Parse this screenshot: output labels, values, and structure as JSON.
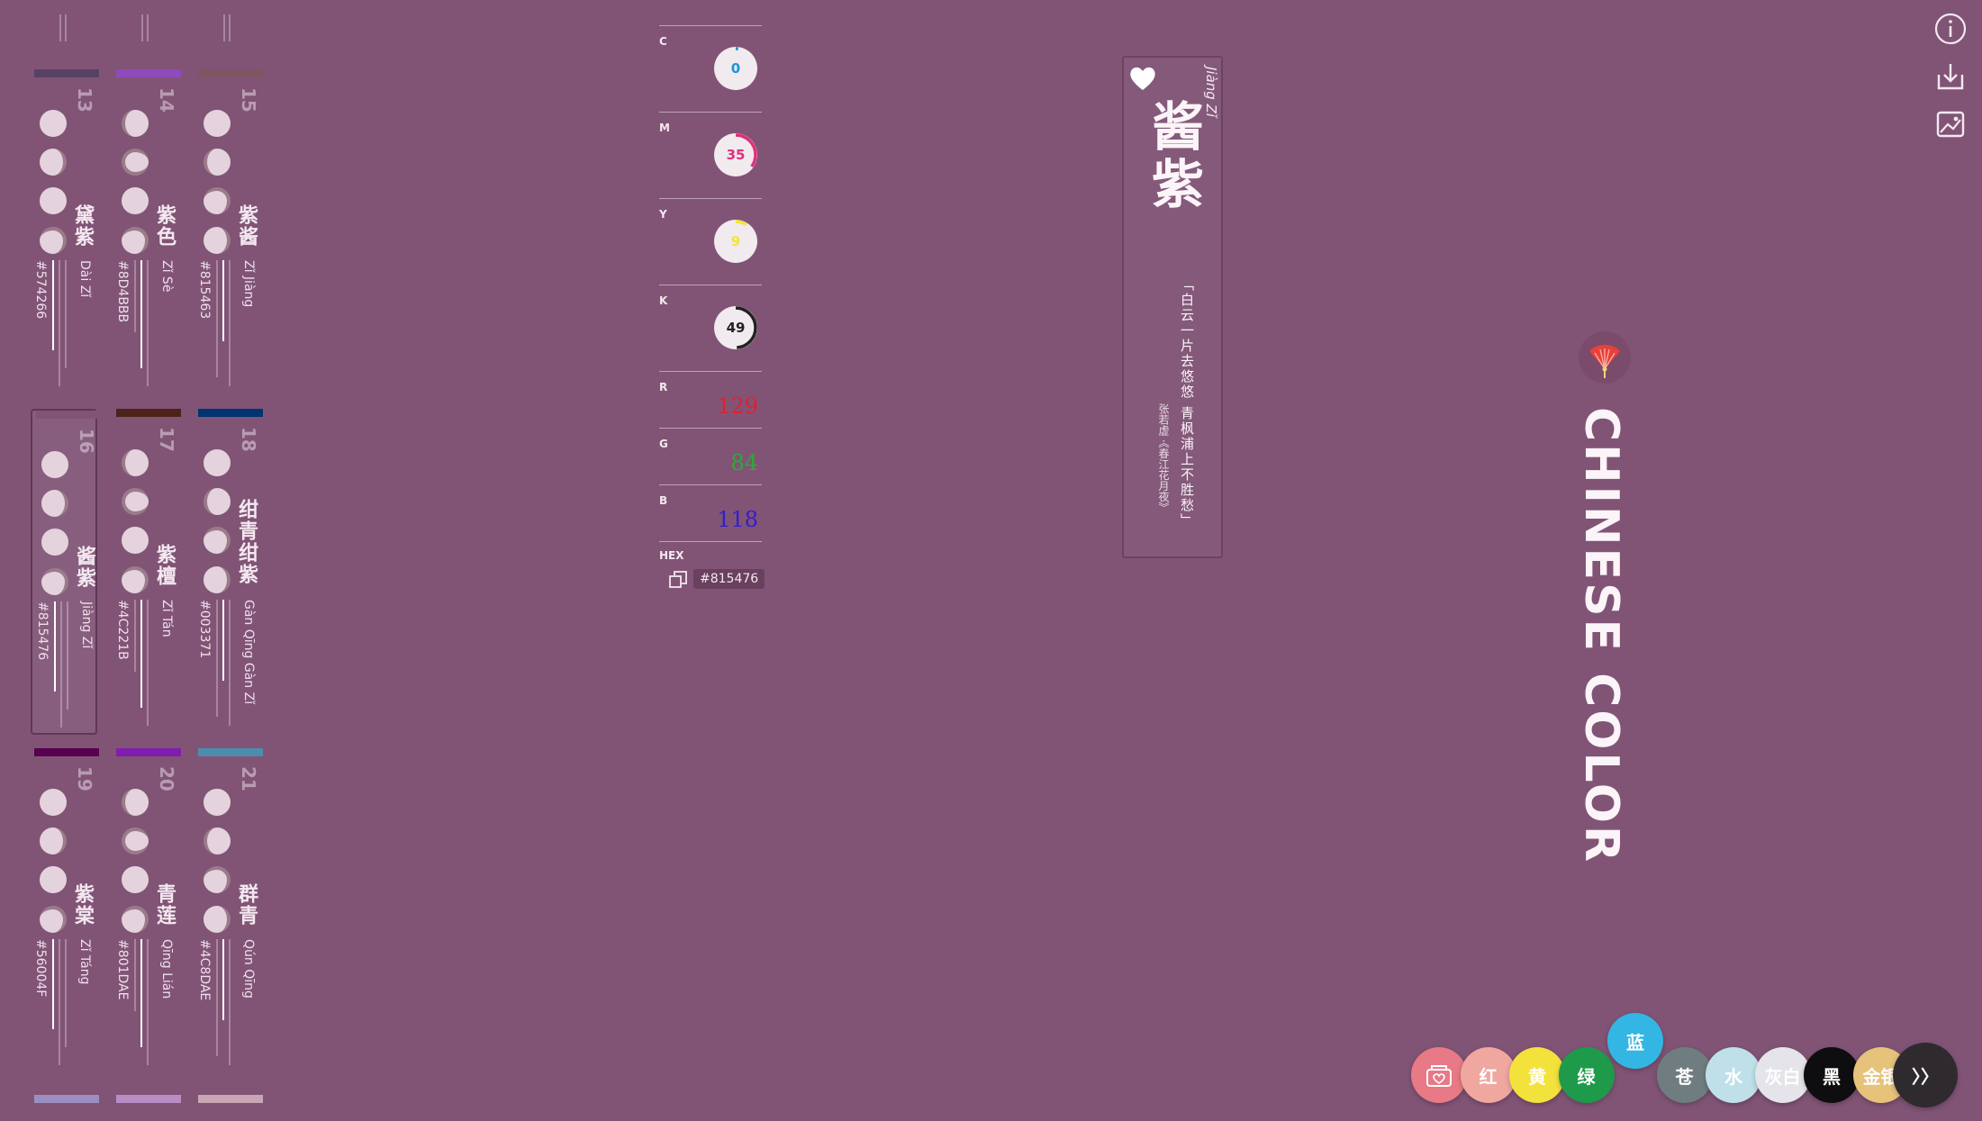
{
  "colors": {
    "page_bg": "#815476",
    "ring_c": "#1f93d8",
    "ring_m": "#e0307a",
    "ring_y": "#f4e43a",
    "ring_k": "#222222",
    "r_text": "#e0202e",
    "g_text": "#2eaa36",
    "b_text": "#3020cc"
  },
  "grid": {
    "cards": [
      {
        "num": "13",
        "name": "黛紫",
        "pinyin": "Dài Zǐ",
        "hex": "#574266"
      },
      {
        "num": "14",
        "name": "紫色",
        "pinyin": "Zǐ Sè",
        "hex": "#8D4BBB"
      },
      {
        "num": "15",
        "name": "紫酱",
        "pinyin": "Zǐ Jiàng",
        "hex": "#815463"
      },
      {
        "num": "16",
        "name": "酱紫",
        "pinyin": "Jiàng Zǐ",
        "hex": "#815476"
      },
      {
        "num": "17",
        "name": "紫檀",
        "pinyin": "Zǐ Tán",
        "hex": "#4C221B"
      },
      {
        "num": "18",
        "name": "绀青绀紫",
        "pinyin": "Gàn Qīng Gàn Zǐ",
        "hex": "#003371"
      },
      {
        "num": "19",
        "name": "紫棠",
        "pinyin": "Zǐ Táng",
        "hex": "#56004F"
      },
      {
        "num": "20",
        "name": "青莲",
        "pinyin": "Qīng Lián",
        "hex": "#801DAE"
      },
      {
        "num": "21",
        "name": "群青",
        "pinyin": "Qún Qīng",
        "hex": "#4C8DAE"
      }
    ],
    "bottom_bars": [
      "#9b8fc2",
      "#b98dc4",
      "#c9a5b5"
    ]
  },
  "detail": {
    "pinyin": "Jiàng Zǐ",
    "name": "酱紫",
    "poem": "「白云一片去悠悠 青枫浦上不胜愁」",
    "author": "张若虚 ·《春江花月夜》"
  },
  "values": {
    "c_label": "C",
    "c": "0",
    "c_pct": 0.02,
    "m_label": "M",
    "m": "35",
    "m_pct": 0.35,
    "y_label": "Y",
    "y": "9",
    "y_pct": 0.09,
    "k_label": "K",
    "k": "49",
    "k_pct": 0.49,
    "r_label": "R",
    "r": "129",
    "g_label": "G",
    "g": "84",
    "b_label": "B",
    "b": "118",
    "hex_label": "HEX",
    "hex": "#815476"
  },
  "brand": {
    "title": "CHINESE COLOR",
    "logo_icon": "fan-icon"
  },
  "toolbar": {
    "info_icon": "info-icon",
    "download_icon": "download-icon",
    "image_icon": "image-icon"
  },
  "palette": {
    "items": [
      {
        "label": "",
        "icon": "favorites-icon",
        "color": "#e77a86"
      },
      {
        "label": "红",
        "color": "#f0a7a0"
      },
      {
        "label": "黄",
        "color": "#f4e23c"
      },
      {
        "label": "绿",
        "color": "#1f9a4a"
      },
      {
        "label": "蓝",
        "color": "#34b6e4",
        "active": true
      },
      {
        "label": "苍",
        "color": "#6f7d80"
      },
      {
        "label": "水",
        "color": "#bfe0e8"
      },
      {
        "label": "灰白",
        "color": "#e4e4ea"
      },
      {
        "label": "黑",
        "color": "#0e0e10"
      },
      {
        "label": "金银",
        "color": "#e6c27a"
      }
    ],
    "next_label": "〉〉"
  }
}
